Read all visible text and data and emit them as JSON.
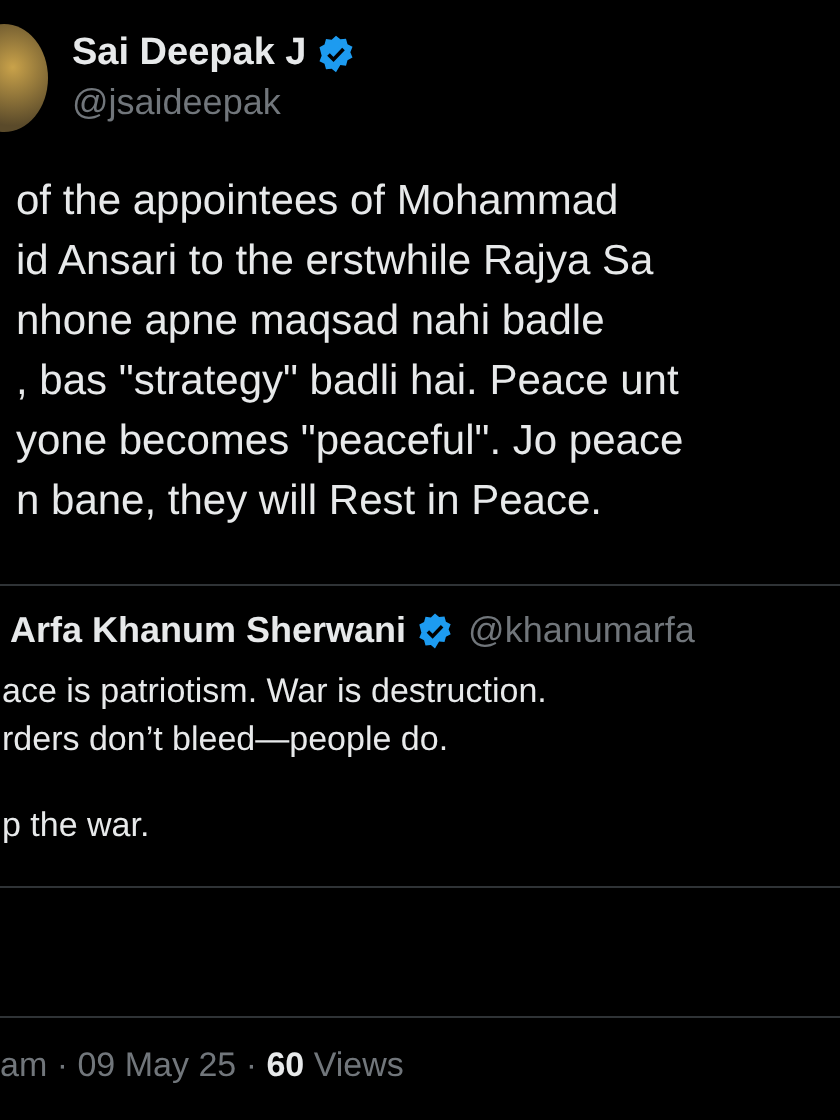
{
  "author": {
    "name": "Sai Deepak J",
    "handle": "@jsaideepak",
    "verified": true
  },
  "text_lines": [
    "of the appointees of Mohammad",
    "id Ansari to the erstwhile Rajya Sa",
    "nhone  apne maqsad nahi badle",
    ", bas \"strategy\" badli hai. Peace unt",
    "yone becomes \"peaceful\". Jo peace",
    "n bane, they will Rest in Peace."
  ],
  "quoted": {
    "name": "Arfa Khanum Sherwani",
    "handle": "@khanumarfa",
    "verified": true,
    "paragraphs": [
      [
        "ace is patriotism. War is destruction.",
        "rders don’t bleed—people do."
      ],
      [
        "p the war."
      ]
    ]
  },
  "footer": "am · 09 May 25 · **60** Views"
}
